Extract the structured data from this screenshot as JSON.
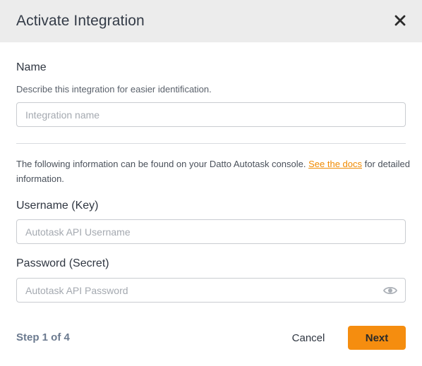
{
  "dialog": {
    "title": "Activate Integration",
    "close_icon": "close-icon"
  },
  "name_section": {
    "label": "Name",
    "hint": "Describe this integration for easier identification.",
    "input_placeholder": "Integration name",
    "input_value": ""
  },
  "info": {
    "text_before": "The following information can be found on your Datto Autotask console.",
    "link_text": "See the docs",
    "text_after": "for detailed information."
  },
  "username_section": {
    "label": "Username (Key)",
    "input_placeholder": "Autotask API Username",
    "input_value": ""
  },
  "password_section": {
    "label": "Password (Secret)",
    "input_placeholder": "Autotask API Password",
    "input_value": "",
    "toggle_icon": "eye-icon"
  },
  "footer": {
    "step_text": "Step 1 of 4",
    "cancel_label": "Cancel",
    "next_label": "Next"
  },
  "colors": {
    "header_bg": "#ececec",
    "accent": "#f58d0f",
    "link": "#f08a00",
    "step_text": "#6b7a8f"
  }
}
